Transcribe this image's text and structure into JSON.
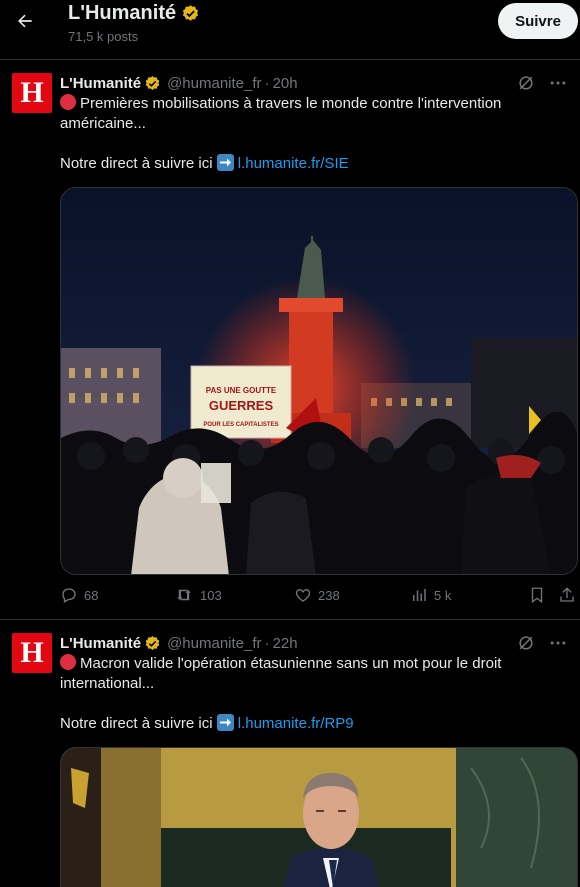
{
  "header": {
    "back_icon": "arrow-left-icon",
    "name": "L'Humanité",
    "posts": "71,5 k posts",
    "follow_label": "Suivre"
  },
  "tweets": [
    {
      "avatar_letter": "H",
      "author": "L'Humanité",
      "handle": "@humanite_fr",
      "separator": "·",
      "time": "20h",
      "text_line1": "Premières mobilisations à travers le monde contre l'intervention américaine...",
      "direct_prefix": "Notre direct à suivre ici",
      "link": "l.humanite.fr/SIE",
      "replies": "68",
      "reposts": "103",
      "likes": "238",
      "views": "5 k",
      "media_sign_1": "PAS UNE GOUTTE",
      "media_sign_2": "GUERRES",
      "media_sign_3": "POUR LES CAPITALISTES"
    },
    {
      "avatar_letter": "H",
      "author": "L'Humanité",
      "handle": "@humanite_fr",
      "separator": "·",
      "time": "22h",
      "text_line1": "Macron valide l'opération étasunienne sans un mot pour le droit international...",
      "direct_prefix": "Notre direct à suivre ici",
      "link": "l.humanite.fr/RP9"
    }
  ],
  "colors": {
    "background": "#000000",
    "text": "#e7e9ea",
    "muted": "#71767b",
    "link": "#1d9bf0",
    "verified": "#e2b719",
    "brand": "#e30613"
  }
}
